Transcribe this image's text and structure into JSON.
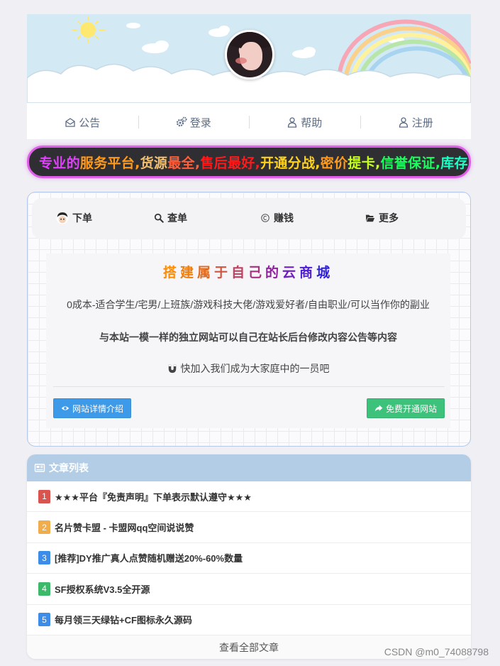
{
  "nav": {
    "items": [
      {
        "label": "公告",
        "icon": "envelope-open-icon"
      },
      {
        "label": "登录",
        "icon": "gears-icon"
      },
      {
        "label": "帮助",
        "icon": "user-icon"
      },
      {
        "label": "注册",
        "icon": "user-icon"
      }
    ]
  },
  "marquee": {
    "segments": [
      {
        "text": "专业的",
        "color": "#e040fb"
      },
      {
        "text": "服务平台,",
        "color": "#ff9a1a"
      },
      {
        "text": "货源",
        "color": "#f0c070"
      },
      {
        "text": "最全,",
        "color": "#ff5e3a"
      },
      {
        "text": "售后最好,",
        "color": "#ff1a1a"
      },
      {
        "text": "开通分战,",
        "color": "#ffd21a"
      },
      {
        "text": "密价",
        "color": "#ff9a1a"
      },
      {
        "text": "提卡,",
        "color": "#c6ff1a"
      },
      {
        "text": "信誉保证,",
        "color": "#1aff5e"
      },
      {
        "text": "库存",
        "color": "#1affc6"
      }
    ]
  },
  "tabs": [
    {
      "label": "下单",
      "icon": "avatar-icon"
    },
    {
      "label": "查单",
      "icon": "search-icon"
    },
    {
      "label": "赚钱",
      "icon": "copyright-circle-icon"
    },
    {
      "label": "更多",
      "icon": "folder-open-icon"
    }
  ],
  "promo": {
    "title_chars": [
      {
        "ch": "搭",
        "color": "#ff8c00"
      },
      {
        "ch": "建",
        "color": "#f07d10"
      },
      {
        "ch": "属",
        "color": "#e06a20"
      },
      {
        "ch": "于",
        "color": "#d05540"
      },
      {
        "ch": "自",
        "color": "#c04060"
      },
      {
        "ch": "己",
        "color": "#a83080"
      },
      {
        "ch": "的",
        "color": "#9020a0"
      },
      {
        "ch": "云",
        "color": "#7020c0"
      },
      {
        "ch": "商",
        "color": "#5020d0"
      },
      {
        "ch": "城",
        "color": "#3020e0"
      }
    ],
    "line1": "0成本-适合学生/宅男/上班族/游戏科技大佬/游戏爱好者/自由职业/可以当作你的副业",
    "line2": "与本站一模一样的独立网站可以自己在站长后台修改内容公告等内容",
    "line3": "快加入我们成为大家庭中的一员吧",
    "btn_detail": "网站详情介绍",
    "btn_open": "免费开通网站"
  },
  "articles": {
    "heading": "文章列表",
    "items": [
      {
        "num": "1",
        "color": "#d9534f",
        "title": "★★★平台『免责声明』下单表示默认遵守★★★"
      },
      {
        "num": "2",
        "color": "#f0ad4e",
        "title": "名片赞卡盟 - 卡盟网qq空间说说赞"
      },
      {
        "num": "3",
        "color": "#3d8de8",
        "title": "[推荐]DY推广真人点赞随机赠送20%-60%数量"
      },
      {
        "num": "4",
        "color": "#3cba6a",
        "title": "SF授权系统V3.5全开源"
      },
      {
        "num": "5",
        "color": "#3d8de8",
        "title": "每月领三天绿钻+CF图标永久源码"
      }
    ],
    "view_all": "查看全部文章"
  },
  "watermark": "CSDN @m0_74088798"
}
